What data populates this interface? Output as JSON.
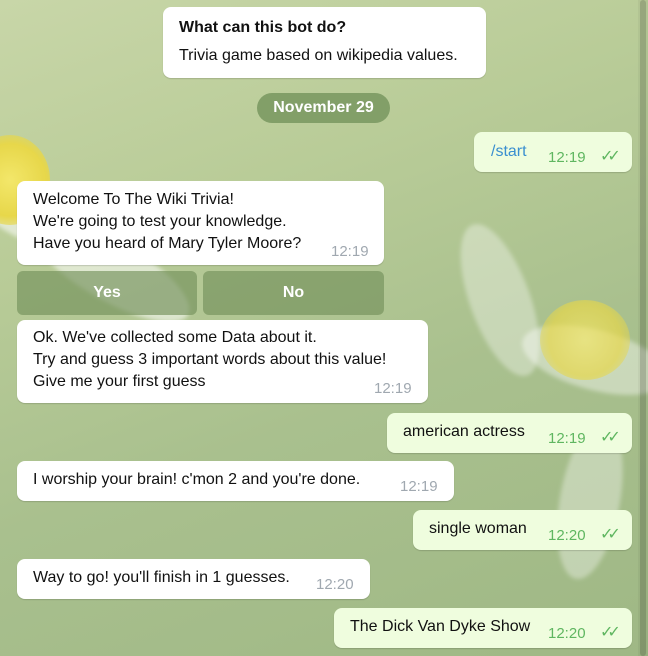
{
  "info": {
    "title": "What can this bot do?",
    "description": "Trivia game based on wikipedia values."
  },
  "date_separator": "November 29",
  "messages": [
    {
      "dir": "out",
      "text": "/start",
      "time": "12:19"
    },
    {
      "dir": "in",
      "text": "Welcome To The Wiki Trivia!\nWe're going to test your knowledge.\nHave you heard of Mary Tyler Moore?",
      "time": "12:19"
    },
    {
      "dir": "in",
      "text": "Ok. We've collected some Data about it.\nTry and guess 3 important words about this value!\nGive me your first guess",
      "time": "12:19"
    },
    {
      "dir": "out",
      "text": "american actress",
      "time": "12:19"
    },
    {
      "dir": "in",
      "text": "I worship your brain! c'mon 2 and you're done.",
      "time": "12:19"
    },
    {
      "dir": "out",
      "text": "single woman",
      "time": "12:20"
    },
    {
      "dir": "in",
      "text": "Way to go! you'll finish in 1 guesses.",
      "time": "12:20"
    },
    {
      "dir": "out",
      "text": "The Dick Van Dyke Show",
      "time": "12:20"
    }
  ],
  "inline_keyboard": [
    "Yes",
    "No"
  ],
  "colors": {
    "incoming_bubble": "#ffffff",
    "outgoing_bubble": "#effdde",
    "outgoing_time": "#5fb660",
    "link_command": "#3a8fd0",
    "keyboard_button": "#73915a"
  },
  "icons": {
    "read_receipt": "double-check-icon"
  }
}
